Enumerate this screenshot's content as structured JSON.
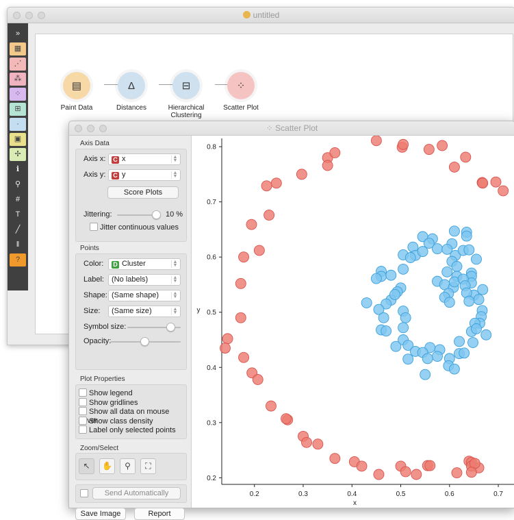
{
  "main_window": {
    "title": "untitled",
    "toolbox": [
      {
        "icon": "expand-icon",
        "color": "#404040",
        "glyph": "»"
      },
      {
        "icon": "data-table-icon",
        "color": "#f3c98b",
        "glyph": "▦"
      },
      {
        "icon": "line-chart-icon",
        "color": "#f3b8b8",
        "glyph": "⋰"
      },
      {
        "icon": "cluster-icon",
        "color": "#f0b3c0",
        "glyph": "⁂"
      },
      {
        "icon": "scatter-icon",
        "color": "#d7b8ef",
        "glyph": "⁘"
      },
      {
        "icon": "grid-icon",
        "color": "#b5e3d4",
        "glyph": "⊞"
      },
      {
        "icon": "points-icon",
        "color": "#c5ddf0",
        "glyph": "∙"
      },
      {
        "icon": "image-icon",
        "color": "#e8e08a",
        "glyph": "▣"
      },
      {
        "icon": "transform-icon",
        "color": "#d8ecb4",
        "glyph": "✢"
      },
      {
        "icon": "info-icon",
        "color": "#404040",
        "glyph": "ℹ"
      },
      {
        "icon": "search-icon",
        "color": "#404040",
        "glyph": "⚲"
      },
      {
        "icon": "hash-icon",
        "color": "#404040",
        "glyph": "#"
      },
      {
        "icon": "text-icon",
        "color": "#404040",
        "glyph": "T"
      },
      {
        "icon": "pen-icon",
        "color": "#404040",
        "glyph": "╱"
      },
      {
        "icon": "pause-icon",
        "color": "#404040",
        "glyph": "‖"
      },
      {
        "icon": "help-icon",
        "color": "#f19a2c",
        "glyph": "?"
      }
    ],
    "nodes": [
      {
        "name": "paint-data-node",
        "label": "Paint Data",
        "color": "#f7d9a7",
        "glyph": "▤"
      },
      {
        "name": "distances-node",
        "label": "Distances",
        "color": "#cfe0ee",
        "glyph": "Δ"
      },
      {
        "name": "hierarchical-clustering-node",
        "label": "Hierarchical Clustering",
        "color": "#cfe0ee",
        "glyph": "⊟"
      },
      {
        "name": "scatter-plot-node",
        "label": "Scatter Plot",
        "color": "#f6c3c3",
        "glyph": "⁘"
      }
    ]
  },
  "scatter_window": {
    "title": "Scatter Plot",
    "axis_data": {
      "title": "Axis Data",
      "axis_x_label": "Axis x:",
      "axis_x_value": "x",
      "axis_y_label": "Axis y:",
      "axis_y_value": "y",
      "var_badge": "C",
      "score_plots": "Score Plots",
      "jittering_label": "Jittering:",
      "jittering_value": "10 %",
      "jitter_continuous": "Jitter continuous values"
    },
    "points": {
      "title": "Points",
      "color_label": "Color:",
      "color_value": "Cluster",
      "color_badge": "D",
      "label_label": "Label:",
      "label_value": "(No labels)",
      "shape_label": "Shape:",
      "shape_value": "(Same shape)",
      "size_label": "Size:",
      "size_value": "(Same size)",
      "symbol_size_label": "Symbol size:",
      "opacity_label": "Opacity:"
    },
    "plot_properties": {
      "title": "Plot Properties",
      "options": [
        "Show legend",
        "Show gridlines",
        "Show all data on mouse hover",
        "Show class density",
        "Label only selected points"
      ]
    },
    "zoom_select": {
      "title": "Zoom/Select"
    },
    "send_automatically": "Send Automatically",
    "save_image": "Save Image",
    "report": "Report"
  },
  "colors": {
    "red": "#ed7d72",
    "blue": "#7fc6ef",
    "red_edge": "#d9534f",
    "blue_edge": "#3aa0dc",
    "var_badge": "#c43d3d",
    "disc_badge": "#3fa040"
  },
  "chart_data": {
    "type": "scatter",
    "xlabel": "x",
    "ylabel": "y",
    "x_ticks": [
      0.2,
      0.3,
      0.4,
      0.5,
      0.6,
      0.7
    ],
    "y_ticks": [
      0.2,
      0.3,
      0.4,
      0.5,
      0.6,
      0.7,
      0.8
    ],
    "xlim": [
      0.133,
      0.735
    ],
    "ylim": [
      0.188,
      0.82
    ],
    "series": [
      {
        "color": "#ed7d72",
        "points": [
          [
            0.45,
            0.811
          ],
          [
            0.503,
            0.799
          ],
          [
            0.505,
            0.804
          ],
          [
            0.558,
            0.795
          ],
          [
            0.585,
            0.802
          ],
          [
            0.35,
            0.78
          ],
          [
            0.365,
            0.789
          ],
          [
            0.35,
            0.766
          ],
          [
            0.297,
            0.75
          ],
          [
            0.633,
            0.781
          ],
          [
            0.61,
            0.763
          ],
          [
            0.245,
            0.734
          ],
          [
            0.225,
            0.729
          ],
          [
            0.667,
            0.735
          ],
          [
            0.668,
            0.734
          ],
          [
            0.695,
            0.736
          ],
          [
            0.71,
            0.72
          ],
          [
            0.23,
            0.676
          ],
          [
            0.194,
            0.659
          ],
          [
            0.21,
            0.612
          ],
          [
            0.178,
            0.6
          ],
          [
            0.172,
            0.552
          ],
          [
            0.172,
            0.49
          ],
          [
            0.145,
            0.452
          ],
          [
            0.14,
            0.435
          ],
          [
            0.178,
            0.418
          ],
          [
            0.195,
            0.39
          ],
          [
            0.207,
            0.378
          ],
          [
            0.234,
            0.33
          ],
          [
            0.268,
            0.305
          ],
          [
            0.265,
            0.307
          ],
          [
            0.3,
            0.275
          ],
          [
            0.307,
            0.264
          ],
          [
            0.33,
            0.261
          ],
          [
            0.365,
            0.235
          ],
          [
            0.405,
            0.229
          ],
          [
            0.42,
            0.221
          ],
          [
            0.455,
            0.206
          ],
          [
            0.5,
            0.221
          ],
          [
            0.51,
            0.211
          ],
          [
            0.532,
            0.206
          ],
          [
            0.555,
            0.222
          ],
          [
            0.56,
            0.222
          ],
          [
            0.615,
            0.209
          ],
          [
            0.64,
            0.23
          ],
          [
            0.645,
            0.228
          ],
          [
            0.645,
            0.221
          ],
          [
            0.66,
            0.218
          ],
          [
            0.652,
            0.226
          ],
          [
            0.645,
            0.21
          ]
        ]
      },
      {
        "color": "#7fc6ef",
        "points": [
          [
            0.545,
            0.637
          ],
          [
            0.565,
            0.633
          ],
          [
            0.61,
            0.647
          ],
          [
            0.605,
            0.624
          ],
          [
            0.635,
            0.645
          ],
          [
            0.635,
            0.638
          ],
          [
            0.525,
            0.618
          ],
          [
            0.53,
            0.603
          ],
          [
            0.558,
            0.625
          ],
          [
            0.575,
            0.615
          ],
          [
            0.595,
            0.614
          ],
          [
            0.612,
            0.603
          ],
          [
            0.628,
            0.612
          ],
          [
            0.64,
            0.613
          ],
          [
            0.655,
            0.596
          ],
          [
            0.505,
            0.604
          ],
          [
            0.52,
            0.599
          ],
          [
            0.545,
            0.61
          ],
          [
            0.505,
            0.578
          ],
          [
            0.46,
            0.574
          ],
          [
            0.46,
            0.565
          ],
          [
            0.45,
            0.561
          ],
          [
            0.48,
            0.567
          ],
          [
            0.605,
            0.592
          ],
          [
            0.615,
            0.583
          ],
          [
            0.615,
            0.565
          ],
          [
            0.595,
            0.573
          ],
          [
            0.645,
            0.571
          ],
          [
            0.645,
            0.565
          ],
          [
            0.645,
            0.553
          ],
          [
            0.668,
            0.541
          ],
          [
            0.65,
            0.531
          ],
          [
            0.66,
            0.523
          ],
          [
            0.667,
            0.503
          ],
          [
            0.665,
            0.492
          ],
          [
            0.662,
            0.48
          ],
          [
            0.575,
            0.556
          ],
          [
            0.59,
            0.55
          ],
          [
            0.608,
            0.545
          ],
          [
            0.61,
            0.555
          ],
          [
            0.628,
            0.56
          ],
          [
            0.632,
            0.548
          ],
          [
            0.635,
            0.535
          ],
          [
            0.64,
            0.52
          ],
          [
            0.5,
            0.544
          ],
          [
            0.493,
            0.537
          ],
          [
            0.48,
            0.522
          ],
          [
            0.488,
            0.532
          ],
          [
            0.47,
            0.515
          ],
          [
            0.43,
            0.517
          ],
          [
            0.598,
            0.534
          ],
          [
            0.59,
            0.527
          ],
          [
            0.6,
            0.518
          ],
          [
            0.505,
            0.502
          ],
          [
            0.51,
            0.49
          ],
          [
            0.455,
            0.505
          ],
          [
            0.465,
            0.49
          ],
          [
            0.505,
            0.472
          ],
          [
            0.46,
            0.468
          ],
          [
            0.47,
            0.466
          ],
          [
            0.505,
            0.45
          ],
          [
            0.515,
            0.44
          ],
          [
            0.49,
            0.438
          ],
          [
            0.53,
            0.429
          ],
          [
            0.56,
            0.436
          ],
          [
            0.58,
            0.432
          ],
          [
            0.545,
            0.427
          ],
          [
            0.575,
            0.42
          ],
          [
            0.555,
            0.416
          ],
          [
            0.515,
            0.415
          ],
          [
            0.6,
            0.416
          ],
          [
            0.62,
            0.425
          ],
          [
            0.63,
            0.426
          ],
          [
            0.648,
            0.445
          ],
          [
            0.645,
            0.465
          ],
          [
            0.652,
            0.48
          ],
          [
            0.655,
            0.47
          ],
          [
            0.675,
            0.459
          ],
          [
            0.598,
            0.403
          ],
          [
            0.61,
            0.397
          ],
          [
            0.55,
            0.387
          ],
          [
            0.62,
            0.447
          ]
        ]
      }
    ]
  }
}
